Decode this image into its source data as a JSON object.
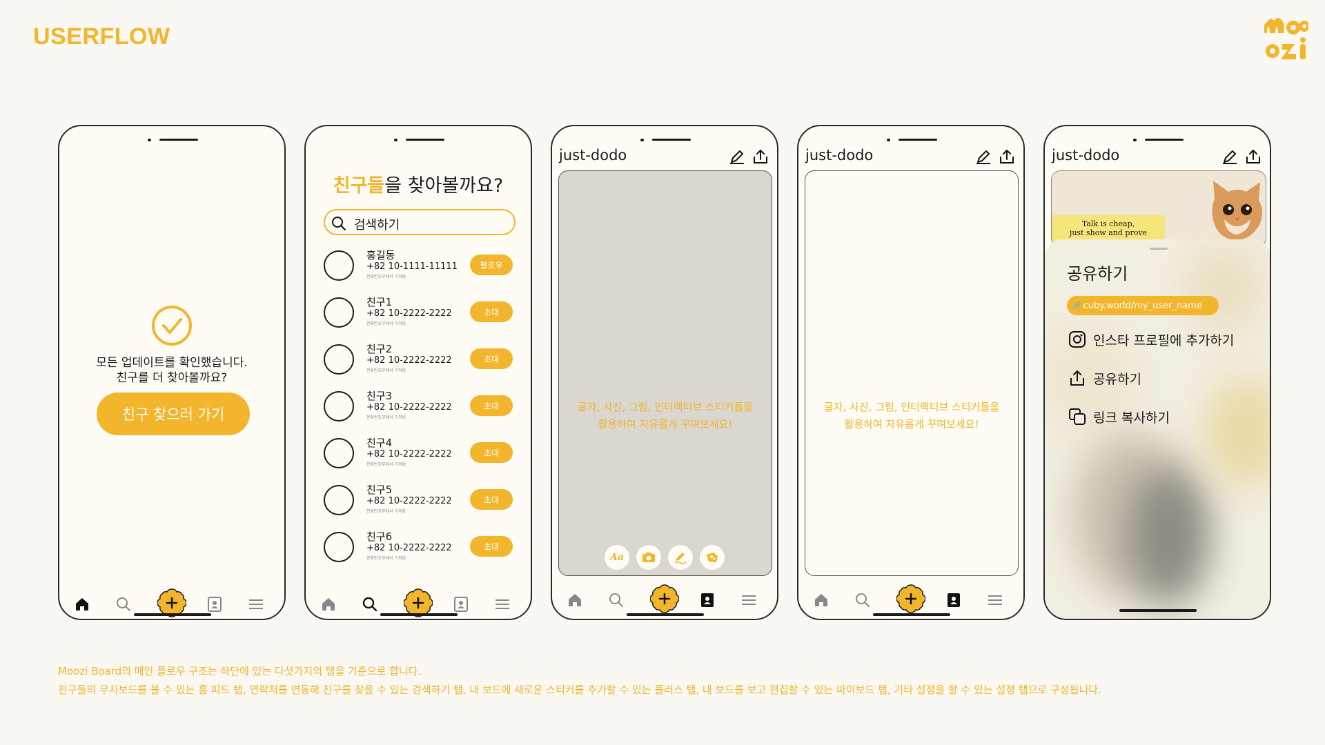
{
  "page": {
    "title": "USERFLOW",
    "logo_text": "moozi"
  },
  "screen1": {
    "message_line1": "모든 업데이트를 확인했습니다.",
    "message_line2": "친구를 더 찾아볼까요?",
    "button_label": "친구 찾으러 가기"
  },
  "screen2": {
    "heading_highlight": "친구들",
    "heading_rest": "을 찾아볼까요?",
    "search_placeholder": "검색하기",
    "friends": [
      {
        "name": "홍길동",
        "phone": "+82 10-1111-11111",
        "sub": "전화번호부에서 가져옴",
        "action": "팔로우"
      },
      {
        "name": "친구1",
        "phone": "+82 10-2222-2222",
        "sub": "전화번호부에서 가져옴",
        "action": "초대"
      },
      {
        "name": "친구2",
        "phone": "+82 10-2222-2222",
        "sub": "전화번호부에서 가져옴",
        "action": "초대"
      },
      {
        "name": "친구3",
        "phone": "+82 10-2222-2222",
        "sub": "전화번호부에서 가져옴",
        "action": "초대"
      },
      {
        "name": "친구4",
        "phone": "+82 10-2222-2222",
        "sub": "전화번호부에서 가져옴",
        "action": "초대"
      },
      {
        "name": "친구5",
        "phone": "+82 10-2222-2222",
        "sub": "전화번호부에서 가져옴",
        "action": "초대"
      },
      {
        "name": "친구6",
        "phone": "+82 10-2222-2222",
        "sub": "전화번호부에서 가져옴",
        "action": "초대"
      }
    ]
  },
  "board": {
    "username": "just-dodo",
    "hint_line1": "글자, 사진, 그림, 인터랙티브 스티커들을",
    "hint_line2": "활용하여 자유롭게 꾸며보세요!",
    "tools": [
      "text-sticker",
      "photo-sticker",
      "draw-sticker",
      "interactive-sticker"
    ]
  },
  "screen5": {
    "username": "just-dodo",
    "image_text_line1": "Talk is cheap,",
    "image_text_line2": "just show and prove",
    "sheet_title": "공유하기",
    "url": "cuby.world/my_user_name",
    "options": [
      {
        "icon": "instagram-icon",
        "label": "인스타 프로필에 추가하기"
      },
      {
        "icon": "share-icon",
        "label": "공유하기"
      },
      {
        "icon": "copy-link-icon",
        "label": "링크 복사하기"
      }
    ]
  },
  "nav_items": [
    "home",
    "search",
    "plus",
    "my-board",
    "menu"
  ],
  "footer": {
    "line1": "Moozi Board의 메인 플로우 구조는 하단에 있는 다섯가지의 탭을 기준으로 합니다.",
    "line2": "친구들의 무지보드를 볼 수 있는 홈 피드 탭, 연락처를 연동해 친구를 찾을 수 있는 검색하기 탭, 내 보드에 새로운 스티커를 추가할 수 있는 플러스 탭, 내 보드를 보고 편집할 수 있는 마이보드 탭, 기타 설정을 할 수 있는 설정 탭으로 구성됩니다."
  },
  "colors": {
    "accent": "#F2B52B",
    "background": "#FAF8F2",
    "phone_bg": "#FEFCF5",
    "canvas_gray": "#D9D7CF"
  }
}
